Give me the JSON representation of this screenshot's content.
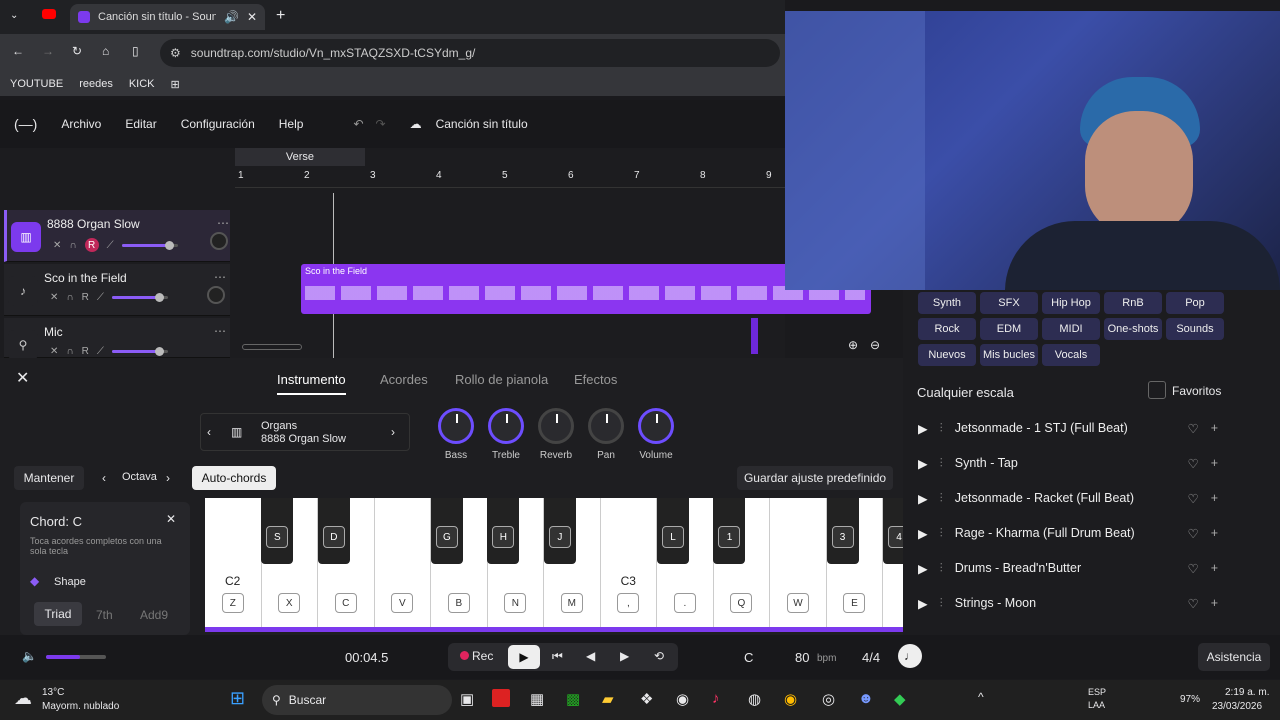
{
  "browser": {
    "tab_title": "Canción sin título - Soundtr",
    "url": "soundtrap.com/studio/Vn_mxSTAQZSXD-tCSYdm_g/",
    "bookmarks": [
      "YOUTUBE",
      "reedes",
      "KICK"
    ]
  },
  "app": {
    "menu": [
      "Archivo",
      "Editar",
      "Configuración",
      "Help"
    ],
    "song_title": "Canción sin título",
    "section_label": "Verse",
    "ruler": [
      "1",
      "2",
      "3",
      "4",
      "5",
      "6",
      "7",
      "8",
      "9"
    ],
    "tracks": [
      {
        "name": "8888 Organ Slow",
        "icon": "piano-icon"
      },
      {
        "name": "Sco in the Field",
        "icon": "guitar-icon"
      },
      {
        "name": "Mic",
        "icon": "mic-icon"
      }
    ],
    "track_ctl_r": "R",
    "clip_label": "Sco in the Field"
  },
  "panel": {
    "tabs": [
      "Instrumento",
      "Acordes",
      "Rollo de pianola",
      "Efectos"
    ],
    "instrument_category": "Organs",
    "instrument_name": "8888 Organ Slow",
    "knobs": [
      "Bass",
      "Treble",
      "Reverb",
      "Pan",
      "Volume"
    ],
    "mantener": "Mantener",
    "octava": "Octava",
    "autochords": "Auto-chords",
    "guardar": "Guardar ajuste predefinido",
    "chord_title": "Chord: C",
    "chord_desc": "Toca acordes completos con una sola tecla",
    "shape": "Shape",
    "shape_opts": [
      "Triad",
      "7th",
      "Add9"
    ],
    "octave_labels": [
      "C2",
      "C3"
    ],
    "white_keys": [
      "Z",
      "X",
      "C",
      "V",
      "B",
      "N",
      "M",
      ",",
      ".",
      "Q",
      "W",
      "E"
    ],
    "black_keys": [
      "S",
      "D",
      "G",
      "H",
      "J",
      "L",
      "1",
      "3",
      "4"
    ]
  },
  "sidebar": {
    "chips": [
      "Synth",
      "SFX",
      "Hip Hop",
      "RnB",
      "Pop",
      "Rock",
      "EDM",
      "MIDI",
      "One-shots",
      "Sounds",
      "Nuevos",
      "Mis bucles",
      "Vocals"
    ],
    "scale": "Cualquier escala",
    "favorites": "Favoritos",
    "loops": [
      "Jetsonmade - 1 STJ (Full Beat)",
      "Synth - Tap",
      "Jetsonmade - Racket (Full Beat)",
      "Rage - Kharma (Full Drum Beat)",
      "Drums - Bread'n'Butter",
      "Strings - Moon"
    ]
  },
  "transport": {
    "time": "00:04.5",
    "rec": "Rec",
    "key": "C",
    "bpm": "80",
    "bpm_unit": "bpm",
    "meter": "4/4",
    "help": "Asistencia"
  },
  "taskbar": {
    "temp": "13°C",
    "weather": "Mayorm. nublado",
    "search": "Buscar",
    "lang1": "ESP",
    "lang2": "LAA",
    "battery": "97%",
    "time": "2:19 a. m.",
    "date": "23/03/2026"
  }
}
